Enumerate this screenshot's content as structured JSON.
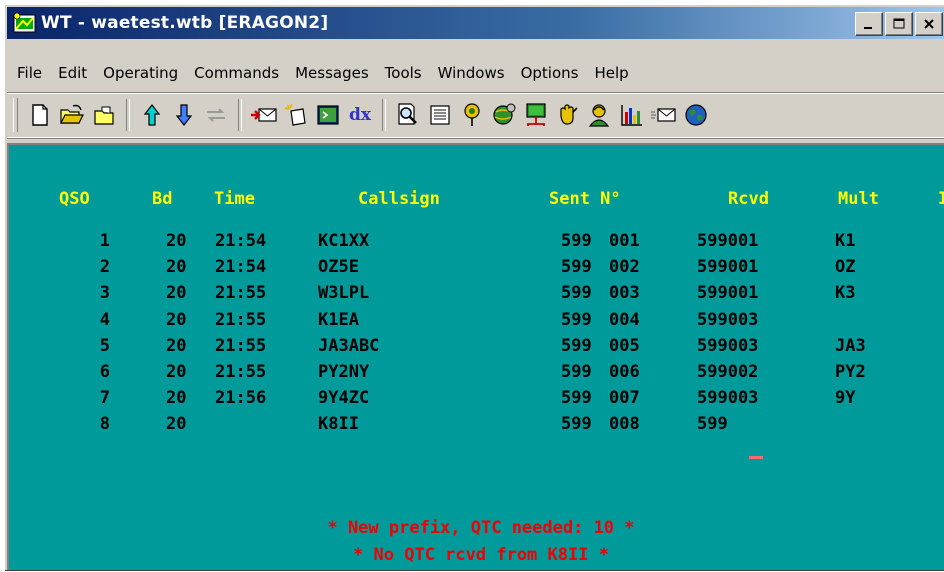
{
  "window": {
    "title": "WT - waetest.wtb [ERAGON2]",
    "buttons": {
      "minimize": "_",
      "maximize": "□",
      "close": "×"
    }
  },
  "menu": [
    "File",
    "Edit",
    "Operating",
    "Commands",
    "Messages",
    "Tools",
    "Windows",
    "Options",
    "Help"
  ],
  "toolbar": {
    "dx_label": "dx"
  },
  "log": {
    "headers": {
      "qso": "QSO",
      "band": "Bd",
      "time": "Time",
      "callsign": "Callsign",
      "sent": "Sent N°",
      "rcvd": "Rcvd",
      "mult": "Mult",
      "more": "I"
    },
    "rows": [
      {
        "qso": "1",
        "band": "20",
        "time": "21:54",
        "callsign": "KC1XX",
        "sent_rst": "599",
        "sent_nr": "001",
        "rcvd": "599001",
        "mult": "K1"
      },
      {
        "qso": "2",
        "band": "20",
        "time": "21:54",
        "callsign": "OZ5E",
        "sent_rst": "599",
        "sent_nr": "002",
        "rcvd": "599001",
        "mult": "OZ"
      },
      {
        "qso": "3",
        "band": "20",
        "time": "21:55",
        "callsign": "W3LPL",
        "sent_rst": "599",
        "sent_nr": "003",
        "rcvd": "599001",
        "mult": "K3"
      },
      {
        "qso": "4",
        "band": "20",
        "time": "21:55",
        "callsign": "K1EA",
        "sent_rst": "599",
        "sent_nr": "004",
        "rcvd": "599003",
        "mult": ""
      },
      {
        "qso": "5",
        "band": "20",
        "time": "21:55",
        "callsign": "JA3ABC",
        "sent_rst": "599",
        "sent_nr": "005",
        "rcvd": "599003",
        "mult": "JA3"
      },
      {
        "qso": "6",
        "band": "20",
        "time": "21:55",
        "callsign": "PY2NY",
        "sent_rst": "599",
        "sent_nr": "006",
        "rcvd": "599002",
        "mult": "PY2"
      },
      {
        "qso": "7",
        "band": "20",
        "time": "21:56",
        "callsign": "9Y4ZC",
        "sent_rst": "599",
        "sent_nr": "007",
        "rcvd": "599003",
        "mult": "9Y"
      },
      {
        "qso": "8",
        "band": "20",
        "time": "",
        "callsign": "K8II",
        "sent_rst": "599",
        "sent_nr": "008",
        "rcvd": "599",
        "mult": ""
      }
    ],
    "messages": [
      "* New prefix, QTC needed: 10 *",
      "* No QTC rcvd from K8II *"
    ]
  },
  "colors": {
    "log_background": "#009a9a",
    "header_text": "#ffff00",
    "row_text": "#000000",
    "message_text": "#ee0000",
    "cursor": "#ff6a6a",
    "titlebar": "#0a246a"
  }
}
